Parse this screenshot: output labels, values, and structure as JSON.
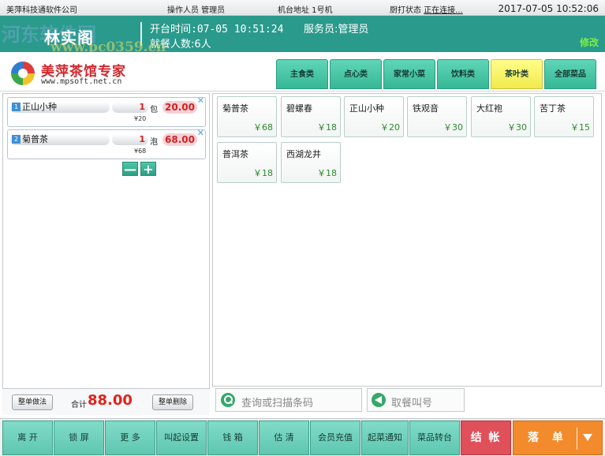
{
  "topbar": {
    "company": "美萍科技通软件公司",
    "operator": "操作人员  管理员",
    "address": "机台地址 1号机",
    "print_status_label": "厨打状态",
    "print_status_value": "正在连接...",
    "datetime": "2017-07-05 10:52:06"
  },
  "table": {
    "name": "林实阁",
    "open_time": "开台时间:07-05 10:51:24",
    "waiter": "服务员:管理员",
    "guests": "就餐人数:6人",
    "edit_label": "修改"
  },
  "watermark": {
    "text": "河东软件园",
    "url": "www.pc0359.cn"
  },
  "logo": {
    "title": "美萍茶馆专家",
    "url": "www.mpsoft.net.cn"
  },
  "tabs": [
    {
      "label": "主食类",
      "active": false
    },
    {
      "label": "点心类",
      "active": false
    },
    {
      "label": "家常小菜",
      "active": false
    },
    {
      "label": "饮料类",
      "active": false
    },
    {
      "label": "茶叶类",
      "active": true
    },
    {
      "label": "全部菜品",
      "active": false
    }
  ],
  "order": {
    "items": [
      {
        "index": "1",
        "name": "正山小种",
        "qty": "1",
        "unit": "包",
        "amount": "20.00",
        "price": "¥20"
      },
      {
        "index": "2",
        "name": "菊普茶",
        "qty": "1",
        "unit": "泡",
        "amount": "68.00",
        "price": "¥68"
      }
    ],
    "minus_label": "—",
    "plus_label": "+",
    "whole_method_label": "整单做法",
    "total_label": "合计",
    "total_value": "88.00",
    "whole_delete_label": "整单删除"
  },
  "dishes": [
    {
      "name": "菊普茶",
      "price": "￥68"
    },
    {
      "name": "碧螺春",
      "price": "￥18"
    },
    {
      "name": "正山小种",
      "price": "￥20"
    },
    {
      "name": "铁观音",
      "price": "￥30"
    },
    {
      "name": "大红袍",
      "price": "￥30"
    },
    {
      "name": "苦丁茶",
      "price": "￥15"
    },
    {
      "name": "普洱茶",
      "price": "￥18"
    },
    {
      "name": "西湖龙井",
      "price": "￥18"
    }
  ],
  "search": {
    "placeholder": "查询或扫描条码",
    "call_label": "取餐叫号"
  },
  "functions": [
    {
      "label": "离 开"
    },
    {
      "label": "锁 屏"
    },
    {
      "label": "更 多"
    },
    {
      "label": "叫起设置"
    },
    {
      "label": "钱 箱"
    },
    {
      "label": "估 清"
    },
    {
      "label": "会员充值"
    },
    {
      "label": "起菜通知"
    },
    {
      "label": "菜品转台"
    }
  ],
  "checkout_label": "结 帐",
  "place_order_label": "落 单",
  "colors": {
    "teal_header": "#2a9a8c",
    "tab_green": "#36b796",
    "tab_active_yellow": "#f1ea4c",
    "price_red": "#e0231c",
    "checkout_red": "#e0505a",
    "order_orange": "#f38a2c"
  }
}
